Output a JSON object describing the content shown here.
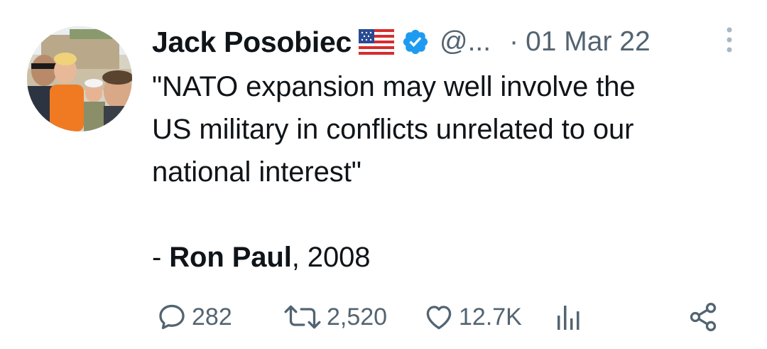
{
  "author": {
    "name": "Jack Posobiec",
    "handle": "@...",
    "flag_icon": "us-flag-icon",
    "verified_icon": "verified-badge-icon"
  },
  "meta": {
    "separator": "·",
    "date": "01 Mar 22"
  },
  "tweet": {
    "lines": [
      "\"NATO expansion may well involve the",
      "US military in conflicts unrelated to our",
      "national interest\""
    ],
    "attribution_prefix": "- ",
    "attribution_name": "Ron Paul",
    "attribution_suffix": ", 2008"
  },
  "actions": {
    "replies": "282",
    "retweets": "2,520",
    "likes": "12.7K"
  },
  "colors": {
    "text": "#0f1419",
    "secondary": "#536471",
    "verified": "#1d9bf0"
  }
}
